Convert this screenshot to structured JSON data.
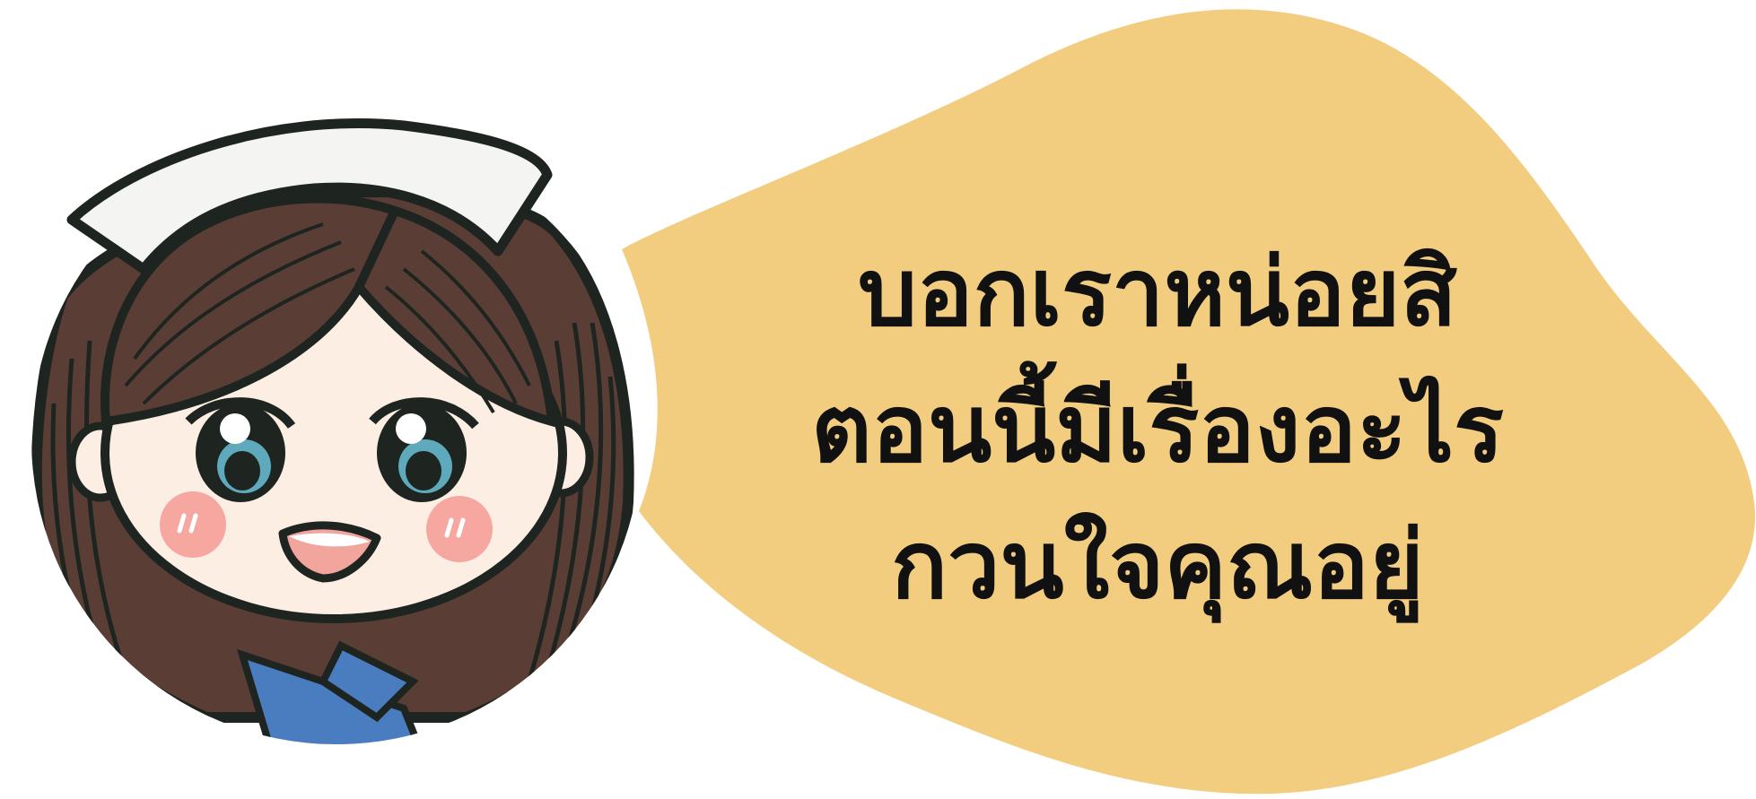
{
  "speech_bubble": {
    "color": "#F2CD80",
    "lines": [
      "บอกเราหน่อยสิ",
      "ตอนนี้มีเรื่องอะไร",
      "กวนใจคุณอยู่"
    ]
  },
  "character": {
    "description_icon": "nurse-character-icon",
    "hair_color": "#5A3E36",
    "skin_color": "#FCEEE2",
    "cap_color": "#F4F4F2",
    "collar_color": "#4A7CC0",
    "outline_color": "#1E2420"
  }
}
